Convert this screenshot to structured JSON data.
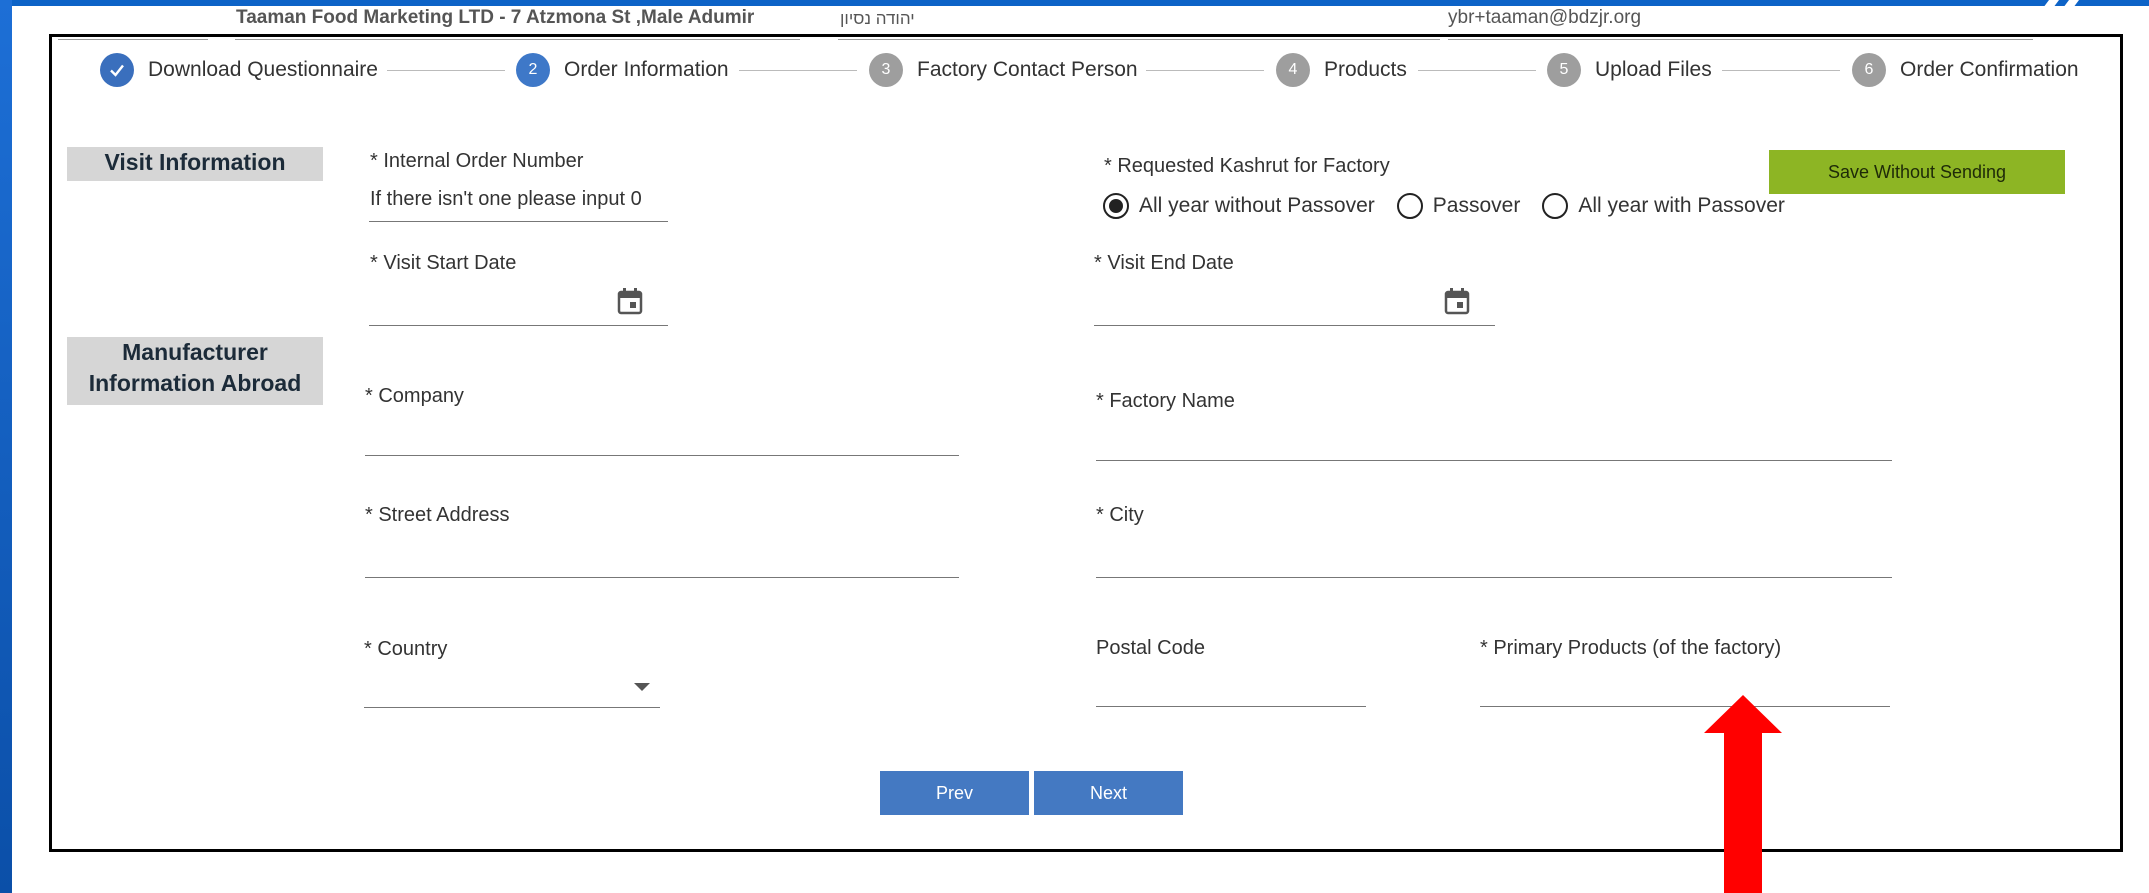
{
  "header": {
    "company": "Taaman Food Marketing LTD - 7 Atzmona St ,Male Adumir",
    "contact_name": "יהודה נסיון",
    "email": "ybr+taaman@bdzjr.org"
  },
  "steps": [
    {
      "number": "",
      "label": "Download Questionnaire",
      "state": "done"
    },
    {
      "number": "2",
      "label": "Order Information",
      "state": "active"
    },
    {
      "number": "3",
      "label": "Factory Contact Person",
      "state": "todo"
    },
    {
      "number": "4",
      "label": "Products",
      "state": "todo"
    },
    {
      "number": "5",
      "label": "Upload Files",
      "state": "todo"
    },
    {
      "number": "6",
      "label": "Order Confirmation",
      "state": "todo"
    }
  ],
  "sections": {
    "visit": "Visit Information",
    "manufacturer_line1": "Manufacturer",
    "manufacturer_line2": "Information Abroad"
  },
  "fields": {
    "internal_order": {
      "label": "* Internal Order Number",
      "value": "If there isn't one please input 0"
    },
    "kashrut": {
      "label": "* Requested Kashrut for Factory",
      "options": [
        "All year without Passover",
        "Passover",
        "All year with Passover"
      ],
      "selected": "All year without Passover"
    },
    "visit_start": {
      "label": "* Visit Start Date",
      "value": ""
    },
    "visit_end": {
      "label": "* Visit End Date",
      "value": ""
    },
    "company": {
      "label": "* Company",
      "value": ""
    },
    "factory_name": {
      "label": "* Factory Name",
      "value": ""
    },
    "street": {
      "label": "* Street Address",
      "value": ""
    },
    "city": {
      "label": "* City",
      "value": ""
    },
    "country": {
      "label": "* Country",
      "value": ""
    },
    "postal": {
      "label": "Postal Code",
      "value": ""
    },
    "primary_products": {
      "label": "* Primary Products (of the factory)",
      "value": ""
    }
  },
  "buttons": {
    "save": "Save Without Sending",
    "prev": "Prev",
    "next": "Next"
  },
  "colors": {
    "accent": "#4479c2",
    "save": "#8db524",
    "arrow": "#ff0000"
  },
  "icons": {
    "calendar": "calendar-icon",
    "check": "check-icon",
    "dropdown": "chevron-down-icon"
  }
}
